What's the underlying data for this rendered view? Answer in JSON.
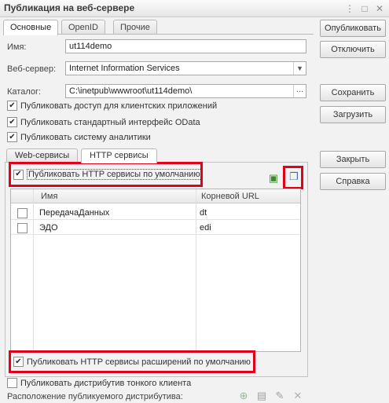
{
  "window": {
    "title": "Публикация на веб-сервере",
    "more_icon": "more-icon",
    "maximize_icon": "maximize-icon",
    "close_icon": "close-icon"
  },
  "tabs": [
    {
      "label": "Основные",
      "active": true
    },
    {
      "label": "OpenID",
      "active": false
    },
    {
      "label": "Прочие",
      "active": false
    }
  ],
  "form": {
    "name_label": "Имя:",
    "name_value": "ut114demo",
    "server_label": "Веб-сервер:",
    "server_value": "Internet Information Services",
    "catalog_label": "Каталог:",
    "catalog_value": "C:\\inetpub\\wwwroot\\ut114demo\\",
    "catalog_button": "...",
    "checkboxes": [
      {
        "label": "Публиковать доступ для клиентских приложений",
        "checked": true
      },
      {
        "label": "Публиковать стандартный интерфейс OData",
        "checked": true
      },
      {
        "label": "Публиковать систему аналитики",
        "checked": true
      }
    ]
  },
  "subtabs": [
    {
      "label": "Web-сервисы",
      "active": false
    },
    {
      "label": "HTTP сервисы",
      "active": true
    }
  ],
  "http": {
    "publish_default_label": "Публиковать HTTP сервисы по умолчанию",
    "publish_default_checked": true,
    "columns": [
      "Имя",
      "Корневой URL"
    ],
    "rows": [
      {
        "checked": false,
        "name": "ПередачаДанных",
        "url": "dt"
      },
      {
        "checked": false,
        "name": "ЭДО",
        "url": "edi"
      }
    ],
    "publish_ext_label": "Публиковать HTTP сервисы расширений по умолчанию",
    "publish_ext_checked": true
  },
  "bottom": {
    "thin_client_label": "Публиковать дистрибутив тонкого клиента",
    "thin_client_checked": false,
    "distrib_label": "Расположение публикуемого дистрибутива:"
  },
  "buttons": {
    "publish": "Опубликовать",
    "unpublish": "Отключить",
    "save": "Сохранить",
    "load": "Загрузить",
    "close": "Закрыть",
    "help": "Справка"
  },
  "colors": {
    "highlight": "#e3001b",
    "background": "#f2f2f2"
  }
}
